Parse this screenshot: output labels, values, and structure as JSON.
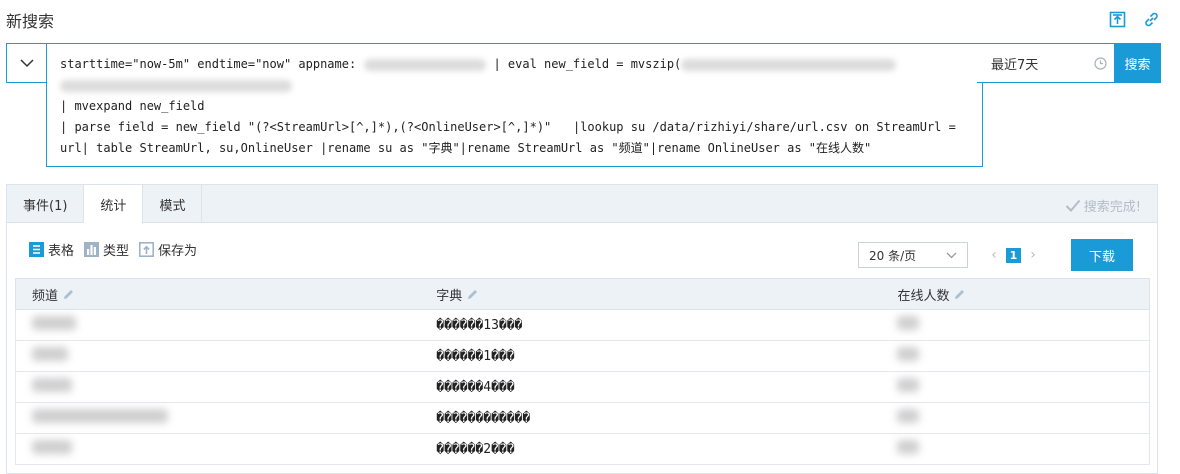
{
  "page": {
    "title": "新搜索"
  },
  "query": {
    "line1_a": "starttime=\"now-5m\" endtime=\"now\" appname:",
    "line1_b": " | eval new_field = mvszip(",
    "line2": "",
    "line3": "| mvexpand new_field",
    "line4": "| parse field = new_field \"(?<StreamUrl>[^,]*),(?<OnlineUser>[^,]*)\"   |lookup su /data/rizhiyi/share/url.csv on StreamUrl =",
    "line5": "url| table StreamUrl, su,OnlineUser |rename su as \"字典\"|rename StreamUrl as \"频道\"|rename OnlineUser as \"在线人数\""
  },
  "time_range": {
    "label": "最近7天"
  },
  "search_button": {
    "label": "搜索"
  },
  "tabs": [
    {
      "label": "事件(1)",
      "active": false
    },
    {
      "label": "统计",
      "active": true
    },
    {
      "label": "模式",
      "active": false
    }
  ],
  "status": {
    "label": "搜索完成!"
  },
  "toolbar": {
    "table": "表格",
    "type": "类型",
    "save_as": "保存为"
  },
  "pager": {
    "per_page": "20 条/页",
    "current_page": "1"
  },
  "download_button": {
    "label": "下载"
  },
  "table": {
    "columns": [
      "频道",
      "字典",
      "在线人数"
    ],
    "rows": [
      {
        "dict": "������13���"
      },
      {
        "dict": "������1���"
      },
      {
        "dict": "������4���"
      },
      {
        "dict": "������������"
      },
      {
        "dict": "������2���"
      }
    ]
  },
  "colors": {
    "accent": "#1a9bd7",
    "header_bg": "#edf2f7",
    "muted": "#b5bcc4"
  },
  "icons": [
    "chevron-down-icon",
    "export-icon",
    "link-icon",
    "clock-icon",
    "check-icon",
    "table-icon",
    "chart-type-icon",
    "save-icon",
    "edit-pencil-icon"
  ]
}
